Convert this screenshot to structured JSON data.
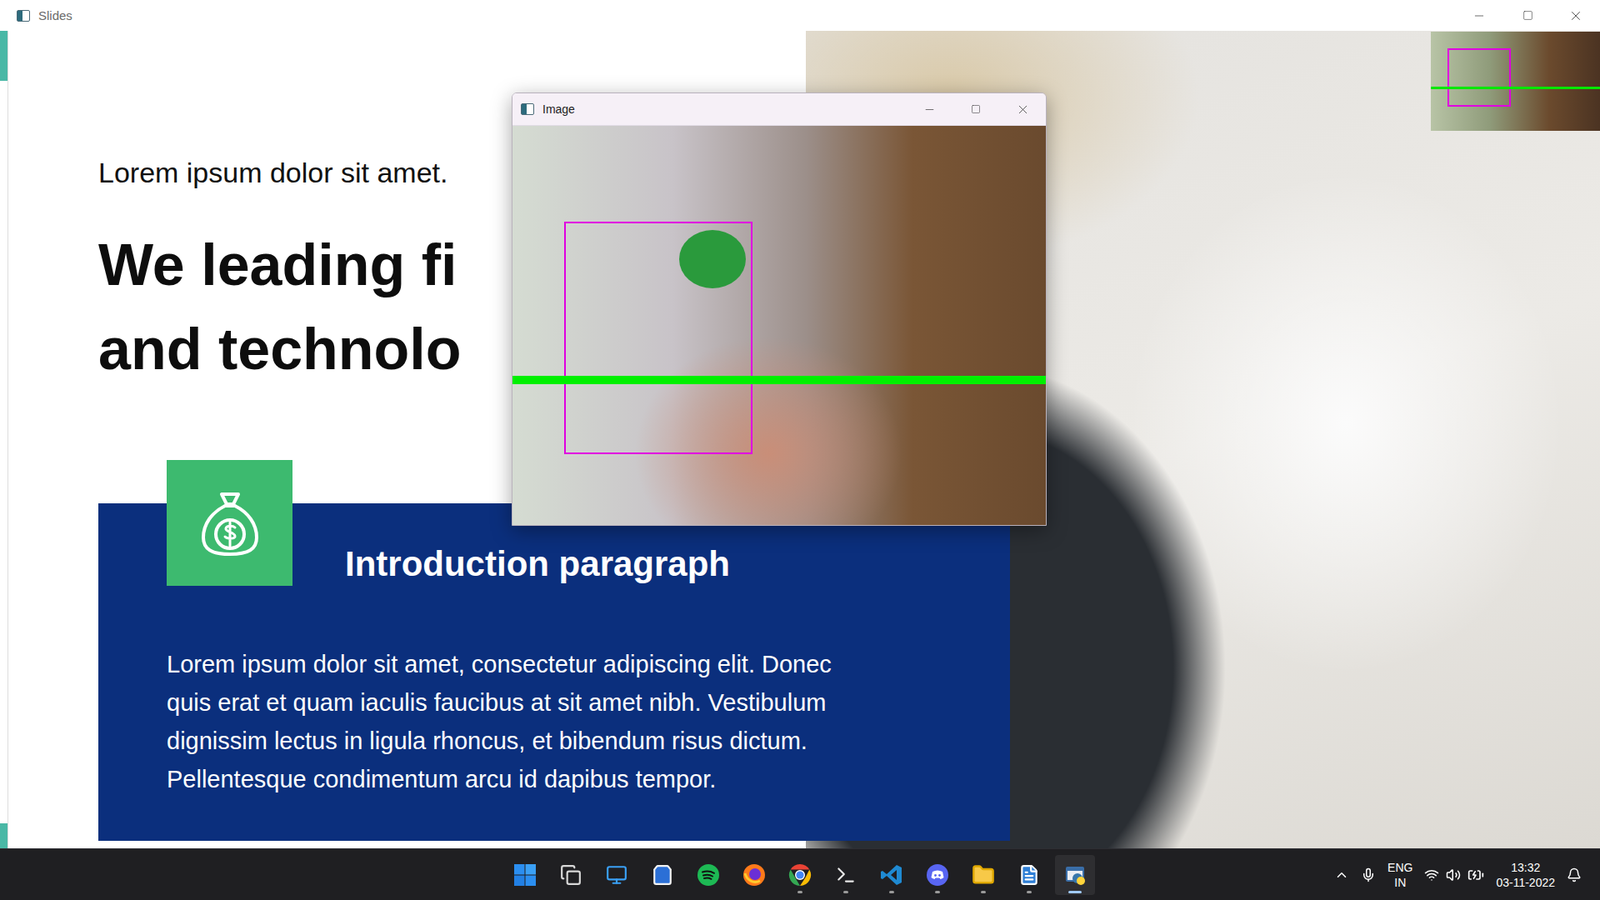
{
  "window": {
    "title": "Slides"
  },
  "slide": {
    "subtitle": "Lorem ipsum dolor sit amet.",
    "heading": [
      "We leading fi",
      "and technolo"
    ],
    "card": {
      "title": "Introduction paragraph",
      "lines": [
        "Lorem ipsum dolor sit amet, consectetur adipiscing elit. Donec",
        "quis erat et quam iaculis faucibus at sit amet nibh. Vestibulum",
        "dignissim lectus in ligula rhoncus, et bibendum risus dictum.",
        "Pellentesque condimentum arcu id dapibus tempor."
      ]
    }
  },
  "image_window": {
    "title": "Image"
  },
  "taskbar": {
    "apps": [
      {
        "running": false,
        "selected": false
      },
      {
        "running": false,
        "selected": false
      },
      {
        "running": false,
        "selected": false
      },
      {
        "running": false,
        "selected": false
      },
      {
        "running": false,
        "selected": false
      },
      {
        "running": false,
        "selected": false
      },
      {
        "running": true,
        "selected": false
      },
      {
        "running": true,
        "selected": false
      },
      {
        "running": true,
        "selected": false
      },
      {
        "running": true,
        "selected": false
      },
      {
        "running": true,
        "selected": false
      },
      {
        "running": true,
        "selected": false
      },
      {
        "running": true,
        "selected": true
      }
    ]
  },
  "tray": {
    "language": "ENG",
    "region": "IN",
    "time": "13:32",
    "date": "03-11-2022"
  }
}
